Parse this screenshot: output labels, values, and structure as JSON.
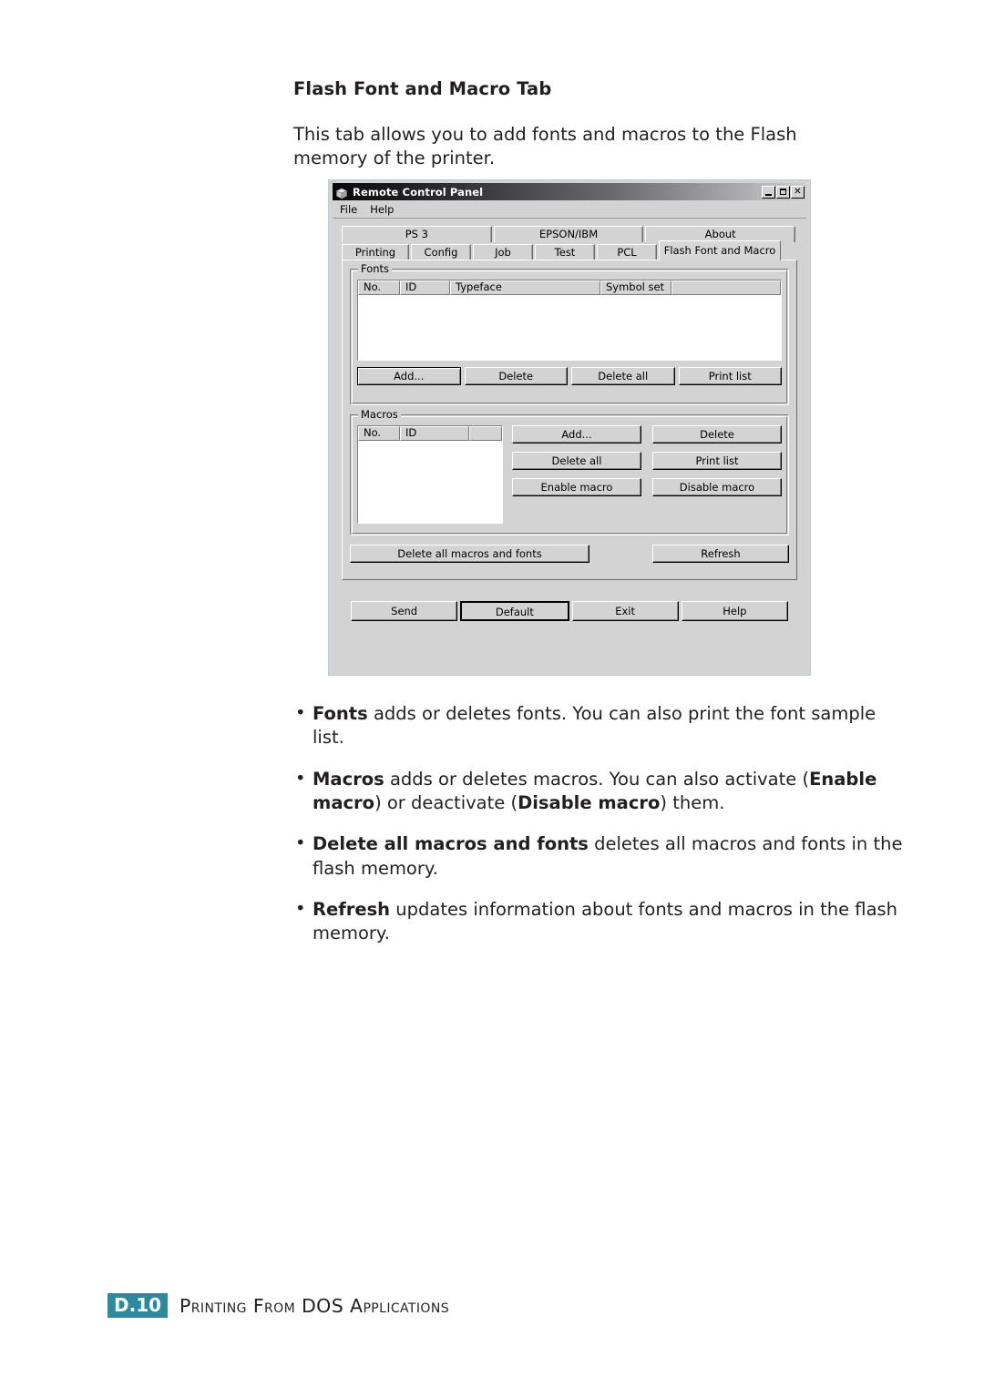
{
  "document": {
    "heading": "Flash Font and Macro Tab",
    "intro": "This tab allows you to add fonts and macros to the Flash memory of the printer.",
    "bullets": [
      {
        "marker": "•",
        "parts": [
          {
            "text": "Fonts",
            "bold": true
          },
          {
            "text": " adds or deletes fonts. You can also print the font sample list.",
            "bold": false
          }
        ]
      },
      {
        "marker": "•",
        "parts": [
          {
            "text": "Macros",
            "bold": true
          },
          {
            "text": " adds or deletes macros. You can also activate (",
            "bold": false
          },
          {
            "text": "Enable macro",
            "bold": true
          },
          {
            "text": ") or deactivate (",
            "bold": false
          },
          {
            "text": "Disable macro",
            "bold": true
          },
          {
            "text": ") them.",
            "bold": false
          }
        ]
      },
      {
        "marker": "•",
        "parts": [
          {
            "text": "Delete all macros and fonts",
            "bold": true
          },
          {
            "text": " deletes all macros and fonts in the flash memory.",
            "bold": false
          }
        ]
      },
      {
        "marker": "•",
        "parts": [
          {
            "text": "Refresh",
            "bold": true
          },
          {
            "text": " updates information about fonts and macros in the flash memory.",
            "bold": false
          }
        ]
      }
    ]
  },
  "footer": {
    "folio": "D.10",
    "title": "Printing From DOS Applications",
    "folio_color": "#2d8a9e"
  },
  "dialog": {
    "title": "Remote Control Panel",
    "icon": "application-cube-icon",
    "window_buttons": [
      {
        "name": "minimize",
        "glyph": ""
      },
      {
        "name": "maximize",
        "glyph": ""
      },
      {
        "name": "close",
        "glyph": "✕"
      }
    ],
    "menu": [
      "File",
      "Help"
    ],
    "tabs_top": [
      "PS 3",
      "EPSON/IBM",
      "About"
    ],
    "tabs_bottom": [
      "Printing",
      "Config",
      "Job",
      "Test",
      "PCL",
      "Flash Font and Macro"
    ],
    "selected_tab": "Flash Font and Macro",
    "fonts_group": {
      "label": "Fonts",
      "columns": [
        "No.",
        "ID",
        "Typeface",
        "Symbol set",
        ""
      ],
      "rows": [],
      "buttons": [
        "Add...",
        "Delete",
        "Delete all",
        "Print list"
      ],
      "focused_button": "Add..."
    },
    "macros_group": {
      "label": "Macros",
      "columns": [
        "No.",
        "ID",
        ""
      ],
      "rows": [],
      "buttons": [
        "Add...",
        "Delete",
        "Delete all",
        "Print list",
        "Enable macro",
        "Disable macro"
      ]
    },
    "tab_bottom_buttons": [
      "Delete all macros and fonts",
      "Refresh"
    ],
    "dialog_buttons": [
      "Send",
      "Default",
      "Exit",
      "Help"
    ],
    "default_button": "Default"
  }
}
